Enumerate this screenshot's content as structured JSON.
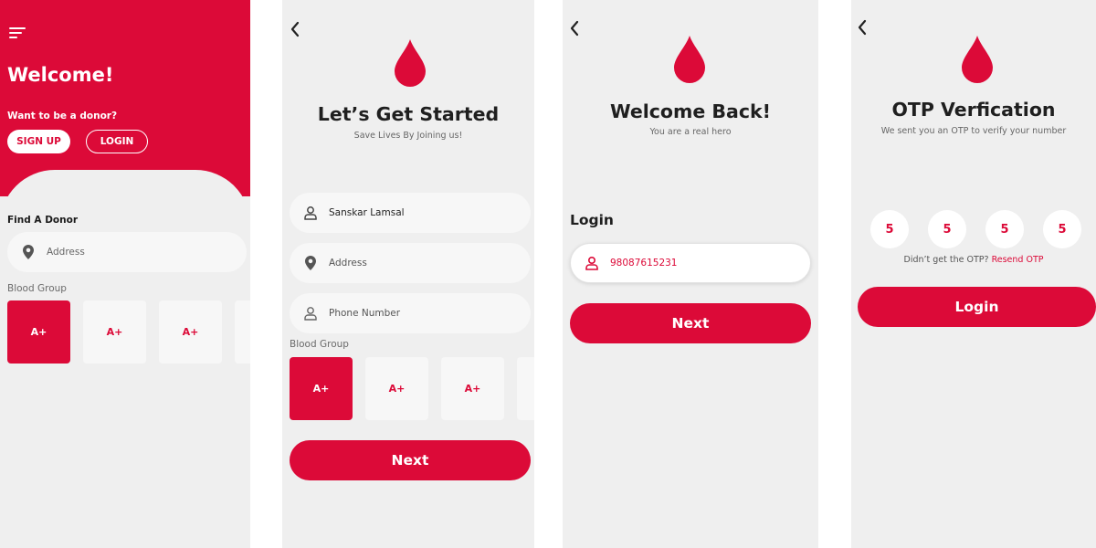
{
  "colors": {
    "accent": "#dc0a38",
    "background": "#efefef",
    "field": "#f7f7f7"
  },
  "screen1": {
    "welcome": "Welcome!",
    "donor_question": "Want to be a donor?",
    "signup_label": "SIGN UP",
    "login_label": "LOGIN",
    "find_donor": "Find A Donor",
    "address_placeholder": "Address",
    "blood_group_label": "Blood Group",
    "blood_groups": [
      "A+",
      "A+",
      "A+"
    ]
  },
  "screen2": {
    "title": "Let’s Get Started",
    "subtitle": "Save Lives By Joining us!",
    "name_value": "Sanskar Lamsal",
    "address_placeholder": "Address",
    "phone_placeholder": "Phone Number",
    "blood_group_label": "Blood Group",
    "blood_groups": [
      "A+",
      "A+",
      "A+"
    ],
    "next_label": "Next"
  },
  "screen3": {
    "title": "Welcome Back!",
    "subtitle": "You are a real hero",
    "login_label": "Login",
    "phone_value": "98087615231",
    "next_label": "Next"
  },
  "screen4": {
    "title": "OTP Verfication",
    "subtitle": "We sent you an OTP to verify your number",
    "otp_digits": [
      "5",
      "5",
      "5",
      "5"
    ],
    "resend_prompt": "Didn’t get the OTP?",
    "resend_link": "Resend OTP",
    "login_label": "Login"
  },
  "icons": [
    "menu-icon",
    "back-icon",
    "blood-drop-icon",
    "location-pin-icon",
    "user-icon"
  ]
}
